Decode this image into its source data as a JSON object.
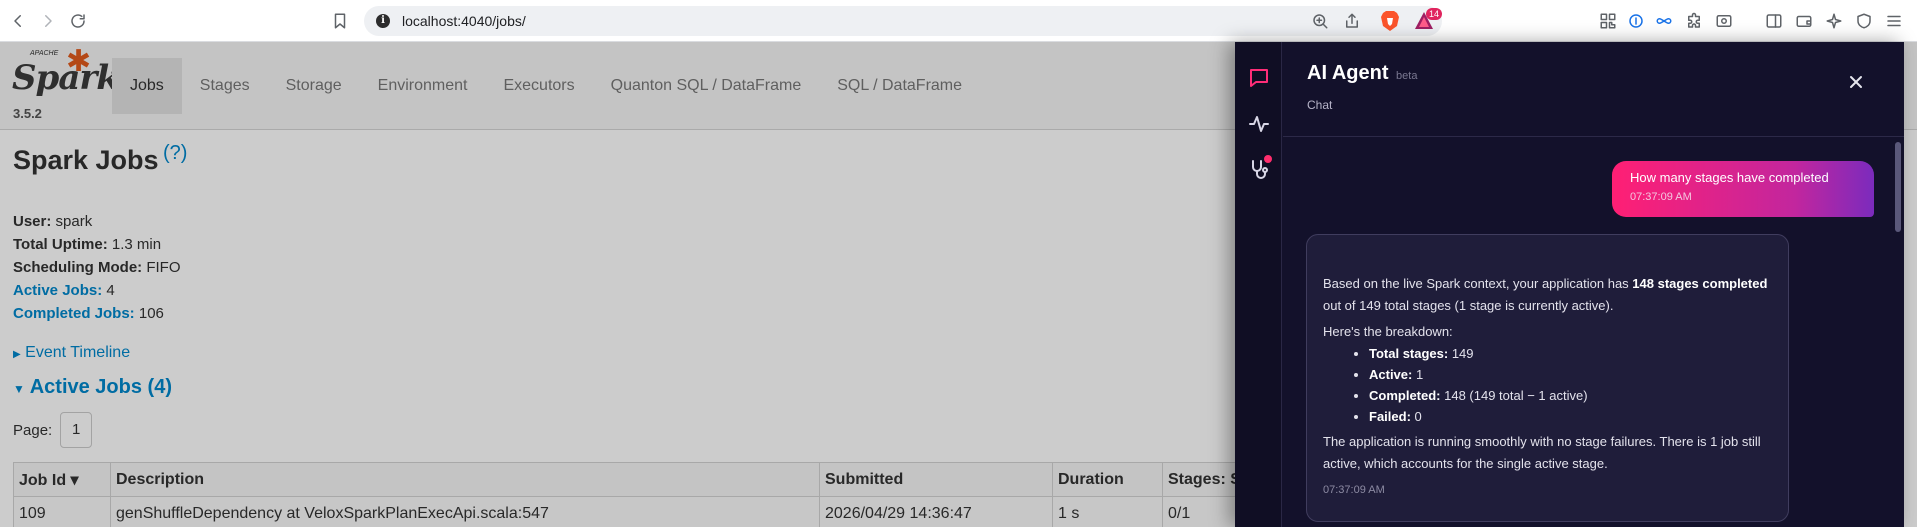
{
  "browser": {
    "url": "localhost:4040/jobs/",
    "rewards_count": "14"
  },
  "spark": {
    "logo_small": "APACHE",
    "logo_word": "Spark",
    "version": "3.5.2",
    "tabs": [
      {
        "label": "Jobs"
      },
      {
        "label": "Stages"
      },
      {
        "label": "Storage"
      },
      {
        "label": "Environment"
      },
      {
        "label": "Executors"
      },
      {
        "label": "Quanton SQL / DataFrame"
      },
      {
        "label": "SQL / DataFrame"
      }
    ],
    "title": "Spark Jobs",
    "help": "(?)",
    "summary": {
      "user_label": "User:",
      "user_value": "spark",
      "uptime_label": "Total Uptime:",
      "uptime_value": "1.3 min",
      "sched_label": "Scheduling Mode:",
      "sched_value": "FIFO",
      "active_label": "Active Jobs:",
      "active_value": "4",
      "completed_label": "Completed Jobs:",
      "completed_value": "106"
    },
    "event_timeline": "Event Timeline",
    "active_jobs_heading": "Active Jobs (4)",
    "page_label": "Page:",
    "page_value": "1",
    "table": {
      "headers": [
        "Job Id ▾",
        "Description",
        "Submitted",
        "Duration",
        "Stages: Succeeded/Total"
      ],
      "row": [
        "109",
        "genShuffleDependency at VeloxSparkPlanExecApi.scala:547",
        "2026/04/29 14:36:47",
        "1 s",
        "0/1"
      ]
    }
  },
  "agent": {
    "title": "AI Agent",
    "beta": "beta",
    "subtitle": "Chat",
    "user_message": "How many stages have completed",
    "user_time": "07:37:09 AM",
    "bot": {
      "p1_a": "Based on the live Spark context, your application has ",
      "p1_b": "148 stages completed",
      "p1_c": " out of 149 total stages (1 stage is currently active).",
      "p2": "Here's the breakdown:",
      "items": [
        {
          "label": "Total stages:",
          "value": " 149"
        },
        {
          "label": "Active:",
          "value": " 1"
        },
        {
          "label": "Completed:",
          "value": " 148 (149 total − 1 active)"
        },
        {
          "label": "Failed:",
          "value": " 0"
        }
      ],
      "p3": "The application is running smoothly with no stage failures. There is 1 job still active, which accounts for the single active stage.",
      "time": "07:37:09 AM"
    }
  }
}
